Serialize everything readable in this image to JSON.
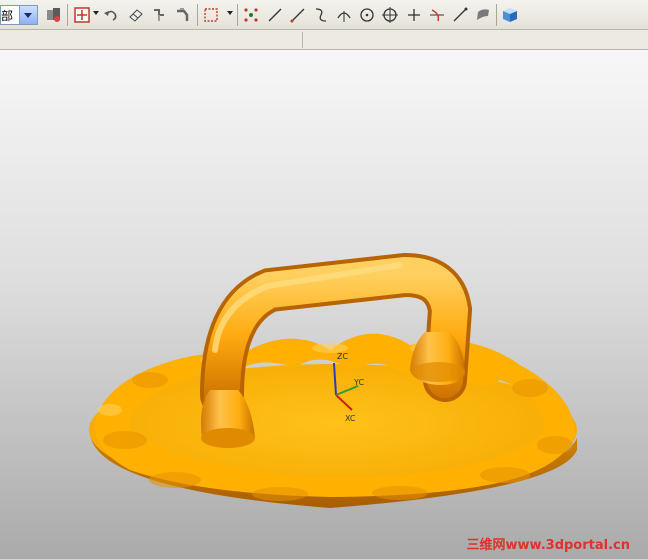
{
  "toolbar": {
    "selection_filter_value": "部",
    "icons": [
      "selection-filter-dropdown",
      "type-filter-icon",
      "snap-point-icon",
      "undo-icon",
      "eraser-icon",
      "move-icon",
      "rotate-icon",
      "box-select-icon",
      "point-constructor-icon",
      "line-icon",
      "line-angled-icon",
      "spline-icon",
      "arc-icon",
      "circle-icon",
      "circle-center-icon",
      "point-icon",
      "trim-icon",
      "line-slash-icon",
      "surface-icon",
      "cube-icon"
    ]
  },
  "viewport": {
    "model": "orange-round-lid-with-handle",
    "model_color": "#FFB300",
    "background_top": "#f7f7f7",
    "background_bottom": "#aaaaaa"
  },
  "axes": {
    "z_label": "ZC",
    "y_label": "YC",
    "x_label": "XC",
    "z_color": "#2a3fc0",
    "y_color": "#2f9e2f",
    "x_color": "#d02020"
  },
  "watermark": {
    "text": "三维网www.3dportal.cn",
    "color": "#e0312a"
  }
}
